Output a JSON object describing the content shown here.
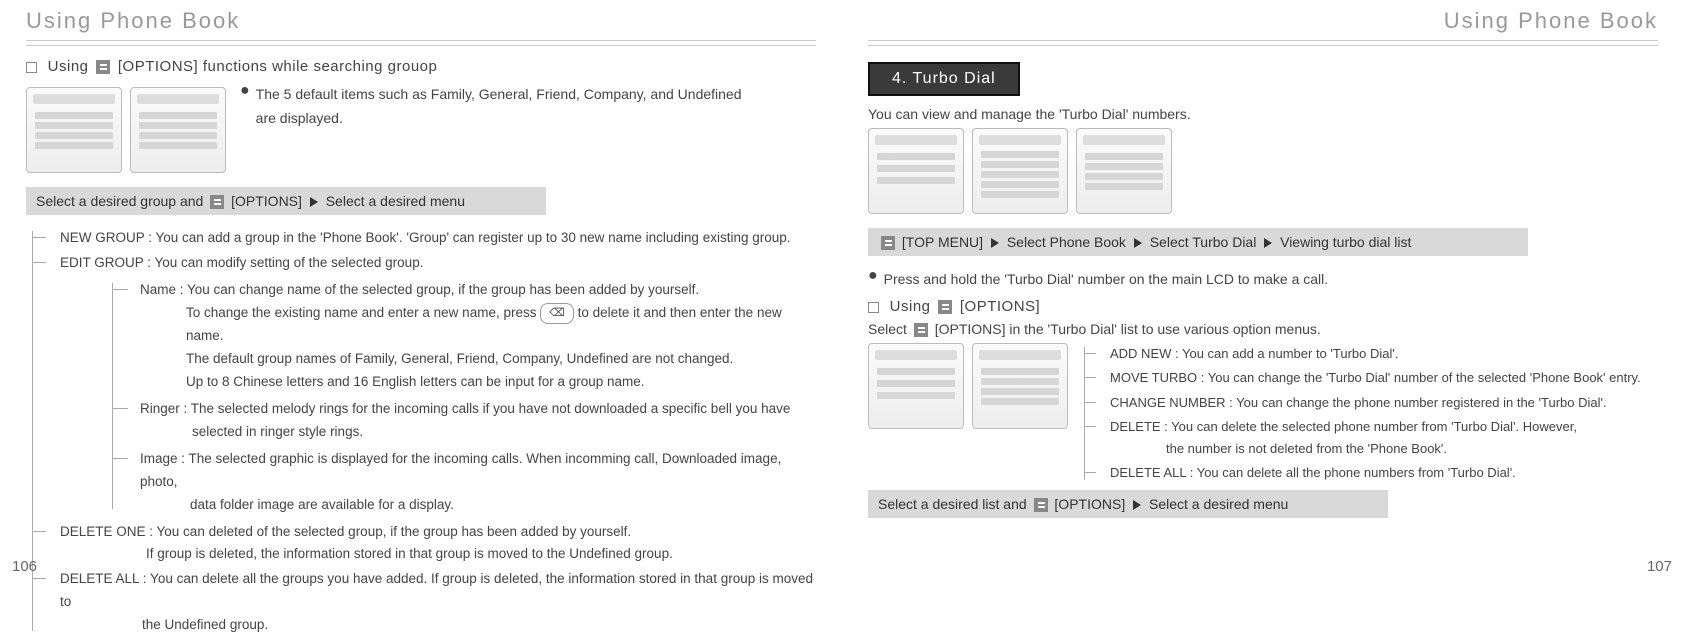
{
  "left": {
    "header": "Using Phone Book",
    "subhead_prefix": "Using",
    "subhead_suffix": "[OPTIONS] functions while searching grouop",
    "note1": "The 5 default items such as Family, General, Friend, Company, and Undefined",
    "note2": "are displayed.",
    "graybar_a": "Select a desired group and",
    "graybar_b": "[OPTIONS]",
    "graybar_c": "Select a desired menu",
    "tree": {
      "newgroup": "NEW GROUP : You can add a group in the 'Phone Book'. 'Group' can register up to 30 new name including existing group.",
      "editgroup": "EDIT GROUP : You can modify setting of the selected group.",
      "name0": "Name : You can change name of the selected group, if the group has been added by yourself.",
      "name1": "To change the existing name and enter a new name, press",
      "name1b": "to delete it and then enter the new name.",
      "name2": "The default group names of Family, General, Friend, Company, Undefined are not changed.",
      "name3": "Up to 8 Chinese letters and 16 English letters can be input for a group name.",
      "ringer0": "Ringer : The selected melody rings for the incoming calls if you have not downloaded a specific bell you have",
      "ringer1": "selected in ringer style rings.",
      "image0": "Image : The selected graphic is displayed for the incoming calls. When incomming call, Downloaded image, photo,",
      "image1": "data folder image are available for a display.",
      "delone0": "DELETE ONE : You can deleted of the selected group, if the group has been added by yourself.",
      "delone1": "If group is deleted, the information stored in that group is moved to the Undefined group.",
      "delall0": "DELETE ALL : You can delete all the groups you have added. If group is deleted, the information stored in that group is moved to",
      "delall1": "the Undefined group."
    },
    "pagenum": "106"
  },
  "right": {
    "header": "Using Phone Book",
    "section_title": "4. Turbo Dial",
    "intro": "You can view and manage the 'Turbo Dial' numbers.",
    "top_a": "[TOP MENU]",
    "top_b": "Select Phone Book",
    "top_c": "Select Turbo Dial",
    "top_d": "Viewing turbo dial list",
    "press": "Press and hold the 'Turbo Dial' number on the main LCD to make a call.",
    "u_prefix": "Using",
    "u_suffix": "[OPTIONS]",
    "select_text_a": "Select",
    "select_text_b": "[OPTIONS] in the 'Turbo Dial' list to use various option menus.",
    "tree": {
      "add": "ADD NEW : You can add a number to 'Turbo Dial'.",
      "move": "MOVE TURBO : You can change the 'Turbo Dial' number of the selected 'Phone Book' entry.",
      "change": "CHANGE NUMBER : You can change the phone number registered in the 'Turbo Dial'.",
      "del0": "DELETE : You can delete the selected phone number from 'Turbo Dial'. However,",
      "del1": "the number is not deleted from the 'Phone Book'.",
      "delall": "DELETE ALL : You can delete all the phone numbers from 'Turbo Dial'."
    },
    "graybar_a": "Select a desired list and",
    "graybar_b": "[OPTIONS]",
    "graybar_c": "Select a desired menu",
    "pagenum": "107"
  }
}
